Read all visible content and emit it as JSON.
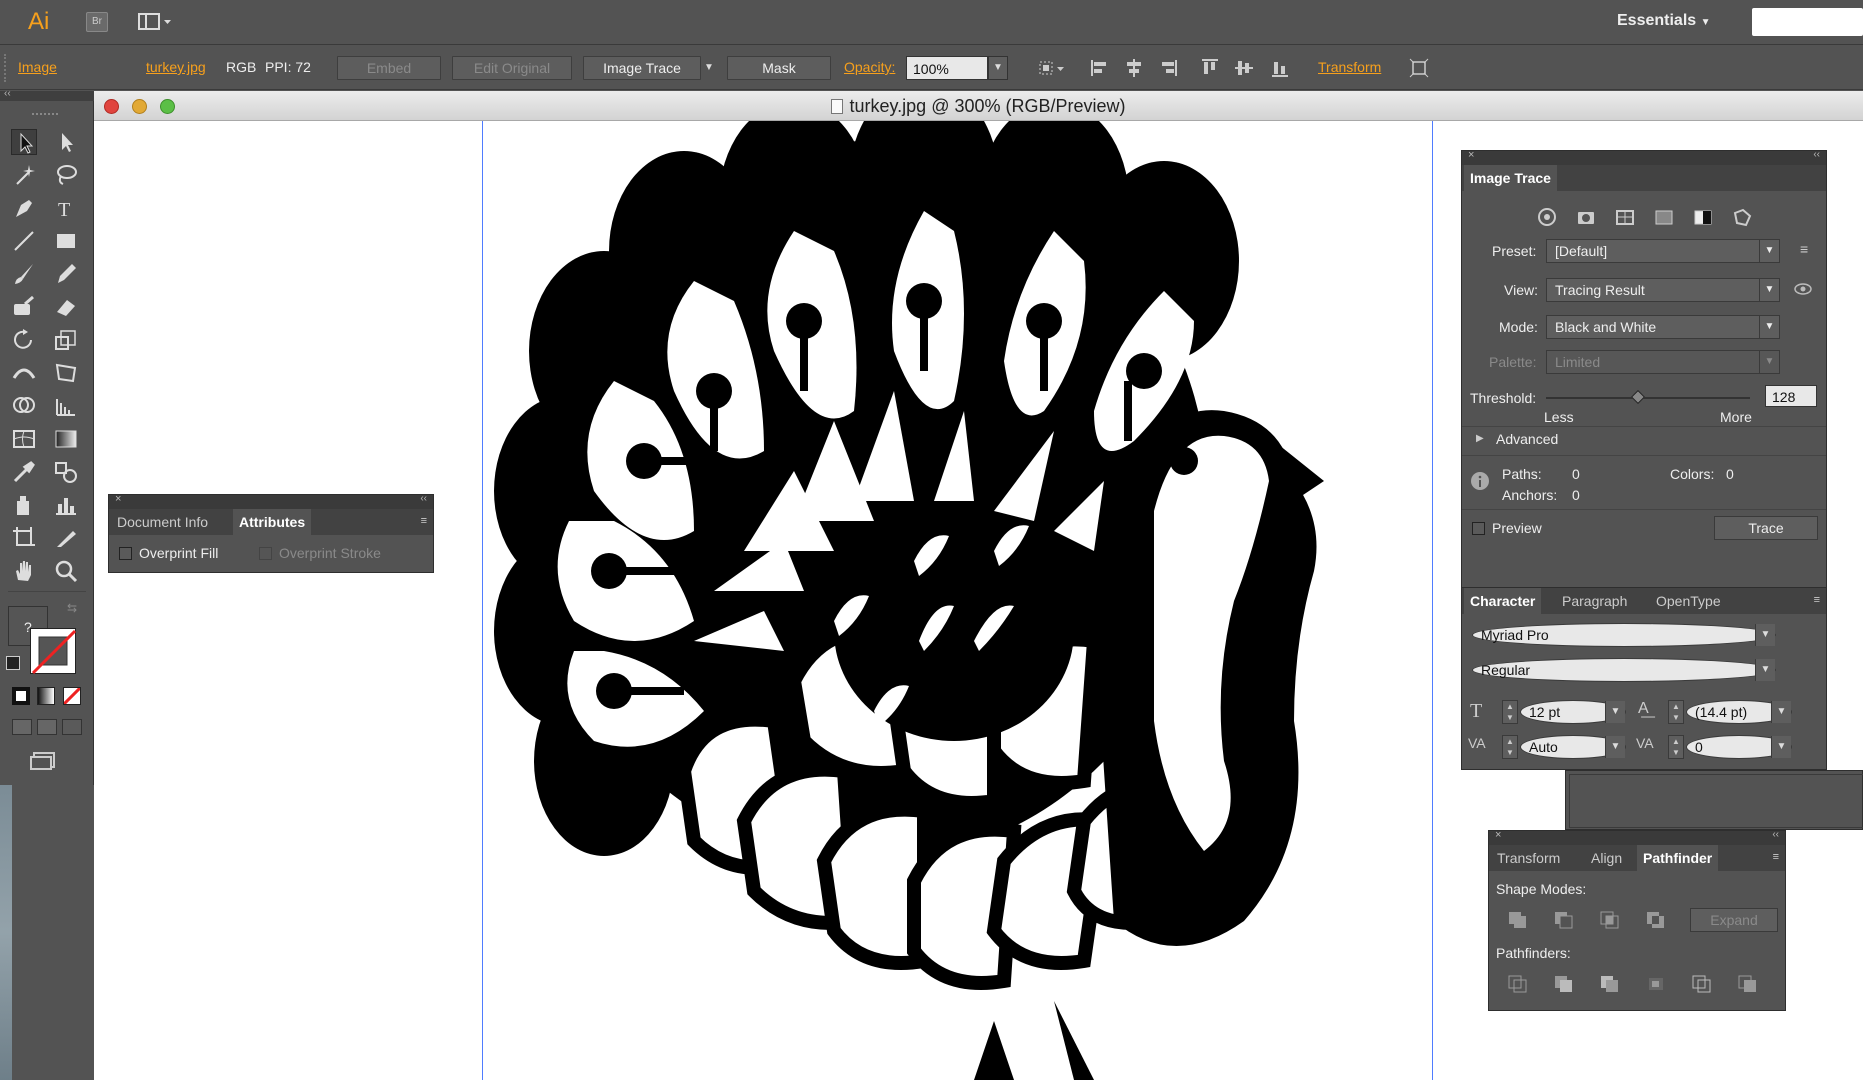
{
  "app": {
    "logo": "Ai",
    "bridge": "Br",
    "workspace": "Essentials"
  },
  "control_bar": {
    "selection_type": "Image",
    "file_name": "turkey.jpg",
    "color_mode": "RGB",
    "ppi": "PPI: 72",
    "embed": "Embed",
    "edit_original": "Edit Original",
    "image_trace": "Image Trace",
    "mask": "Mask",
    "opacity_label": "Opacity:",
    "opacity_value": "100%",
    "transform": "Transform"
  },
  "document": {
    "title": "turkey.jpg @ 300% (RGB/Preview)"
  },
  "attributes_panel": {
    "tabs": [
      "Document Info",
      "Attributes"
    ],
    "overprint_fill": "Overprint Fill",
    "overprint_stroke": "Overprint Stroke"
  },
  "image_trace_panel": {
    "title": "Image Trace",
    "preset_label": "Preset:",
    "preset_value": "[Default]",
    "view_label": "View:",
    "view_value": "Tracing Result",
    "mode_label": "Mode:",
    "mode_value": "Black and White",
    "palette_label": "Palette:",
    "palette_value": "Limited",
    "threshold_label": "Threshold:",
    "threshold_value": "128",
    "threshold_level": 0.45,
    "less": "Less",
    "more": "More",
    "advanced": "Advanced",
    "paths_label": "Paths:",
    "paths_value": "0",
    "colors_label": "Colors:",
    "colors_value": "0",
    "anchors_label": "Anchors:",
    "anchors_value": "0",
    "preview": "Preview",
    "trace_button": "Trace"
  },
  "character_panel": {
    "tabs": [
      "Character",
      "Paragraph",
      "OpenType"
    ],
    "font_family": "Myriad Pro",
    "font_style": "Regular",
    "font_size": "12 pt",
    "leading": "(14.4 pt)",
    "kerning": "Auto",
    "tracking": "0"
  },
  "pathfinder_panel": {
    "tabs": [
      "Transform",
      "Align",
      "Pathfinder"
    ],
    "shape_modes": "Shape Modes:",
    "expand": "Expand",
    "pathfinders": "Pathfinders:"
  },
  "colors": {
    "accent": "#f7a01c",
    "artboard_guide": "#4f7cff",
    "panel_bg": "#535353"
  }
}
